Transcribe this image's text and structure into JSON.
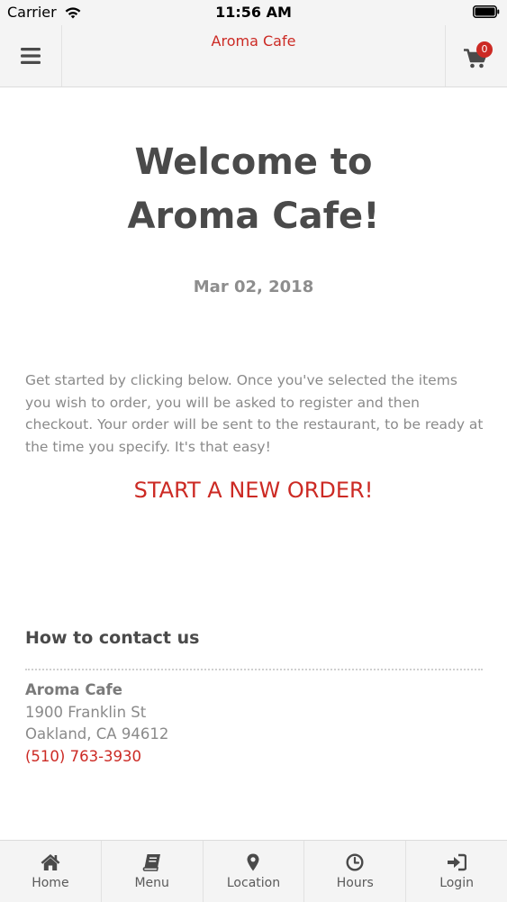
{
  "status_bar": {
    "carrier": "Carrier",
    "time": "11:56 AM"
  },
  "header": {
    "title": "Aroma Cafe",
    "cart_count": "0",
    "menu_icon": "hamburger-menu-icon",
    "cart_icon": "shopping-cart-icon"
  },
  "main": {
    "welcome_line1": "Welcome to",
    "welcome_line2": "Aroma Cafe!",
    "date": "Mar 02, 2018",
    "intro": "Get started by clicking below. Once you've selected the items you wish to order, you will be asked to register and then checkout. Your order will be sent to the restaurant, to be ready at the time you specify. It's that easy!",
    "start_order": "START A NEW ORDER!"
  },
  "contact": {
    "heading": "How to contact us",
    "name": "Aroma Cafe",
    "street": "1900 Franklin St",
    "city": "Oakland, CA 94612",
    "phone": "(510) 763-3930"
  },
  "tabs": [
    {
      "label": "Home",
      "icon": "home-icon"
    },
    {
      "label": "Menu",
      "icon": "book-icon"
    },
    {
      "label": "Location",
      "icon": "map-marker-icon"
    },
    {
      "label": "Hours",
      "icon": "clock-icon"
    },
    {
      "label": "Login",
      "icon": "sign-in-icon"
    }
  ],
  "colors": {
    "accent": "#cc2a24",
    "text_dark": "#4a4a4a",
    "text_muted": "#8a8a8a",
    "bar_bg": "#f4f4f4"
  }
}
